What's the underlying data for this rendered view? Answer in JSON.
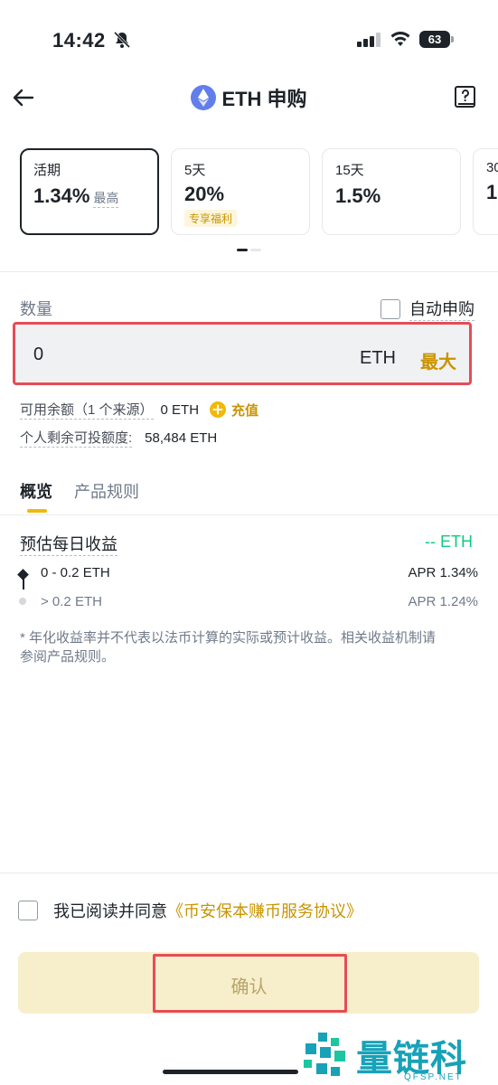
{
  "status_bar": {
    "time": "14:42",
    "battery": "63"
  },
  "header": {
    "title": "ETH 申购"
  },
  "cards": [
    {
      "label": "活期",
      "rate": "1.34%",
      "note": "最高",
      "badge": ""
    },
    {
      "label": "5天",
      "rate": "20%",
      "note": "",
      "badge": "专享福利"
    },
    {
      "label": "15天",
      "rate": "1.5%",
      "note": "",
      "badge": ""
    },
    {
      "label": "30",
      "rate": "1",
      "note": "",
      "badge": ""
    }
  ],
  "amount": {
    "label": "数量",
    "auto_subscribe": "自动申购",
    "value": "0",
    "unit": "ETH",
    "max_label": "最大"
  },
  "balance": {
    "available_label": "可用余额（1 个来源）",
    "available_value": "0 ETH",
    "topup_label": "充值",
    "remaining_label": "个人剩余可投额度:",
    "remaining_value": "58,484 ETH"
  },
  "tabs": {
    "overview": "概览",
    "rules": "产品规则"
  },
  "earnings": {
    "title": "预估每日收益",
    "value": "-- ETH",
    "tiers": [
      {
        "range": "0 - 0.2 ETH",
        "apr": "APR 1.34%"
      },
      {
        "range": "> 0.2 ETH",
        "apr": "APR 1.24%"
      }
    ],
    "footnote": "* 年化收益率并不代表以法币计算的实际或预计收益。相关收益机制请参阅产品规则。"
  },
  "agreement": {
    "text": "我已阅读并同意",
    "link": "《币安保本赚币服务协议》"
  },
  "confirm": {
    "label": "确认"
  },
  "watermark": {
    "text": "量链科技",
    "sub": "QFSP.NET"
  },
  "colors": {
    "accent": "#c99400",
    "yellow": "#f0b90b",
    "green": "#0ecb81",
    "highlight": "#e64c57"
  },
  "icons": {
    "back": "arrow-left-icon",
    "eth": "ethereum-icon",
    "guide": "question-book-icon",
    "bell": "bell-slash-icon",
    "signal": "signal-icon",
    "wifi": "wifi-icon",
    "plus": "plus-circle-icon"
  }
}
